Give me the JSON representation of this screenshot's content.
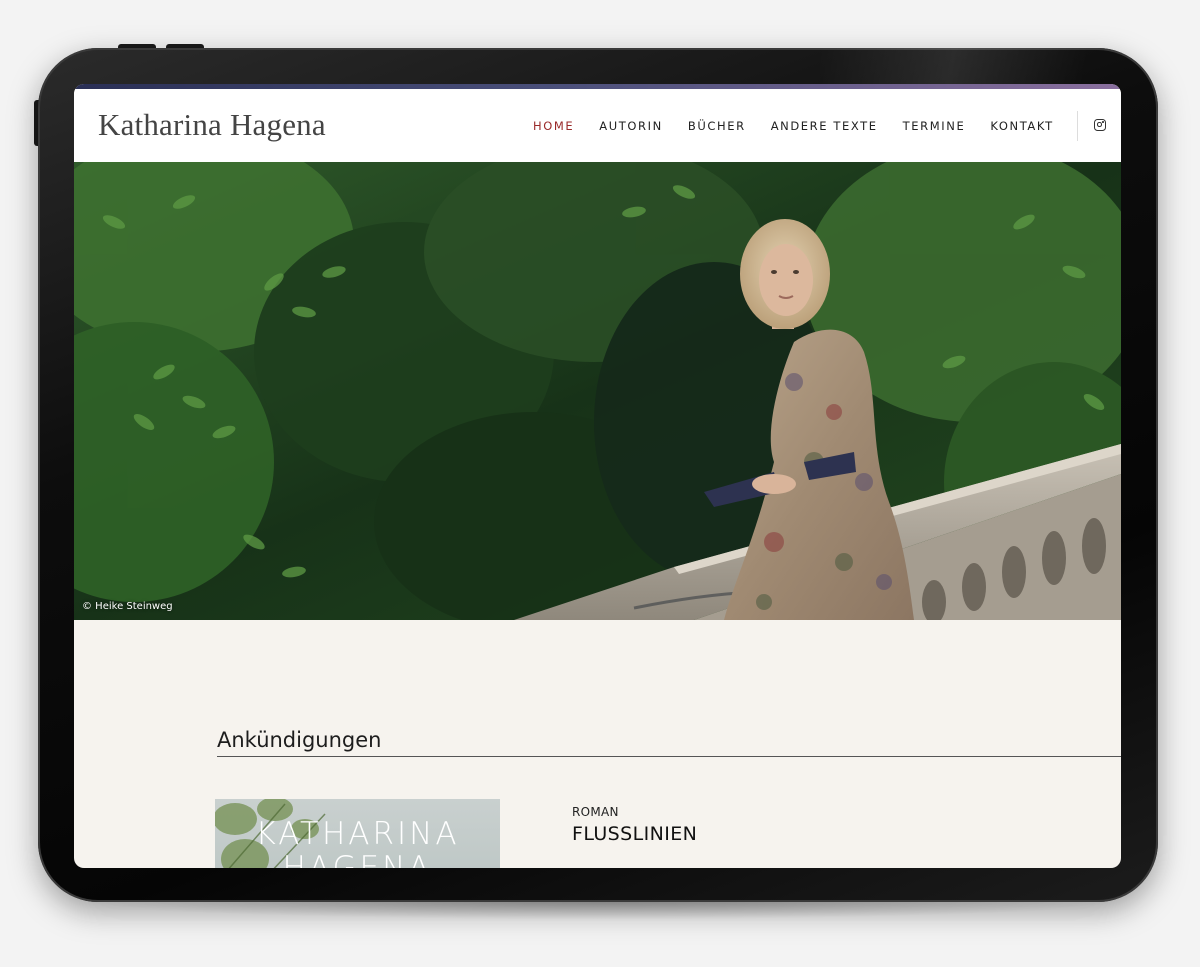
{
  "site": {
    "logo": "Katharina Hagena",
    "nav": [
      {
        "label": "HOME",
        "active": true
      },
      {
        "label": "AUTORIN",
        "active": false
      },
      {
        "label": "BÜCHER",
        "active": false
      },
      {
        "label": "ANDERE TEXTE",
        "active": false
      },
      {
        "label": "TERMINE",
        "active": false
      },
      {
        "label": "KONTAKT",
        "active": false
      }
    ],
    "social_icon": "instagram-icon"
  },
  "hero": {
    "photo_credit": "© Heike Steinweg"
  },
  "announcements": {
    "heading": "Ankündigungen",
    "items": [
      {
        "cover_text": "KATHARINA\nHAGENA",
        "genre": "ROMAN",
        "title": "FLUSSLINIEN"
      }
    ]
  },
  "colors": {
    "accent_active_nav": "#9a2a2a",
    "header_gradient_start": "#2a2f55",
    "header_gradient_end": "#8a6f9e",
    "page_background": "#f6f3ee"
  }
}
